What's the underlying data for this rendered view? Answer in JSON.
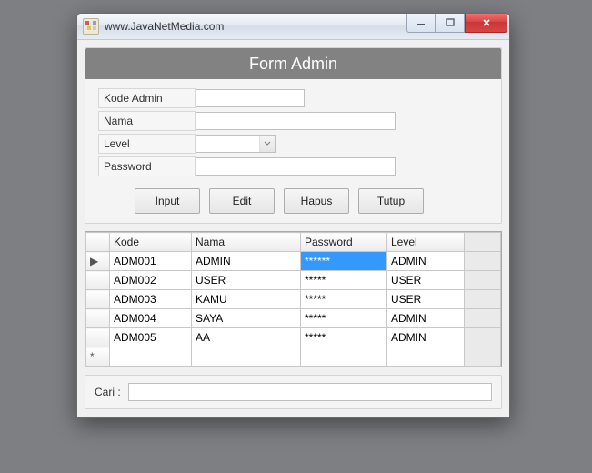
{
  "window": {
    "title": "www.JavaNetMedia.com"
  },
  "form": {
    "heading": "Form Admin",
    "labels": {
      "kode": "Kode Admin",
      "nama": "Nama",
      "level": "Level",
      "password": "Password"
    },
    "values": {
      "kode": "",
      "nama": "",
      "level": "",
      "password": ""
    },
    "buttons": {
      "input": "Input",
      "edit": "Edit",
      "hapus": "Hapus",
      "tutup": "Tutup"
    }
  },
  "grid": {
    "headers": {
      "kode": "Kode",
      "nama": "Nama",
      "password": "Password",
      "level": "Level"
    },
    "rows": [
      {
        "kode": "ADM001",
        "nama": "ADMIN",
        "password": "******",
        "level": "ADMIN",
        "current": true,
        "sel": "password"
      },
      {
        "kode": "ADM002",
        "nama": "USER",
        "password": "*****",
        "level": "USER"
      },
      {
        "kode": "ADM003",
        "nama": "KAMU",
        "password": "*****",
        "level": "USER"
      },
      {
        "kode": "ADM004",
        "nama": "SAYA",
        "password": "*****",
        "level": "ADMIN"
      },
      {
        "kode": "ADM005",
        "nama": "AA",
        "password": "*****",
        "level": "ADMIN"
      }
    ],
    "current_marker": "▶",
    "new_marker": "*"
  },
  "search": {
    "label": "Cari :",
    "value": ""
  }
}
